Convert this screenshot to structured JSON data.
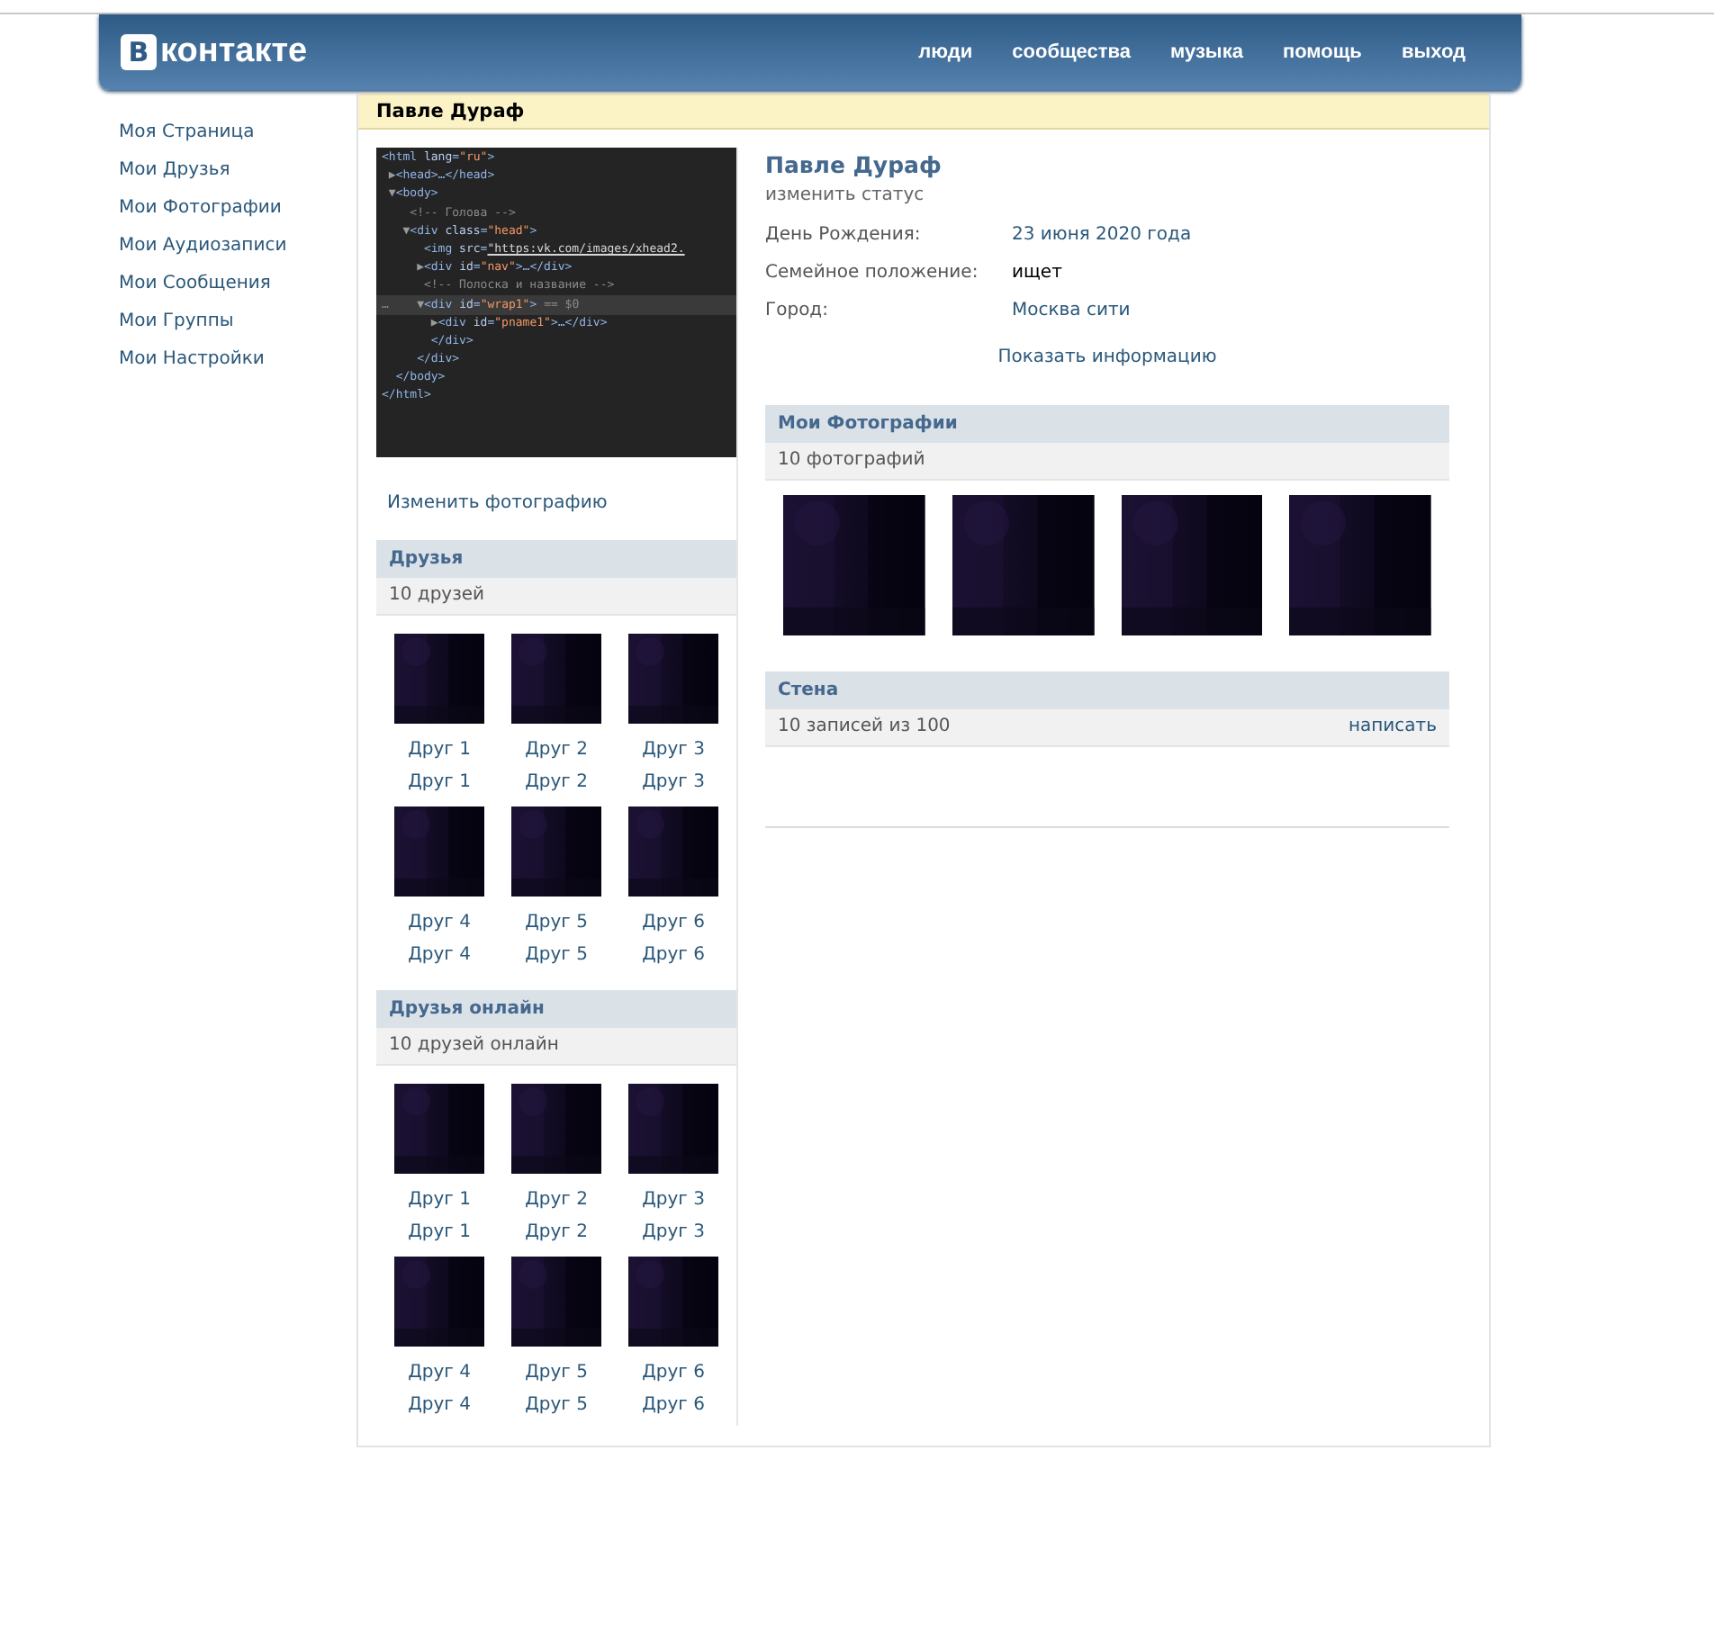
{
  "header": {
    "logo_mark": "В",
    "logo_text": "контакте",
    "nav": [
      "люди",
      "сообщества",
      "музыка",
      "помощь",
      "выход"
    ]
  },
  "sidebar": {
    "items": [
      "Моя Страница",
      "Мои Друзья",
      "Мои Фотографии",
      "Мои Аудиозаписи",
      "Мои Сообщения",
      "Мои Группы",
      "Мои Настройки"
    ]
  },
  "page_title": "Павле Дураф",
  "avatar_code": [
    {
      "highlighted": false,
      "segments": [
        {
          "kind": "tag",
          "text": "<html "
        },
        {
          "kind": "attr",
          "text": "lang"
        },
        {
          "kind": "tag",
          "text": "="
        },
        {
          "kind": "value",
          "text": "\"ru\""
        },
        {
          "kind": "tag",
          "text": ">"
        }
      ]
    },
    {
      "highlighted": false,
      "segments": [
        {
          "kind": "arrow",
          "text": " ▶"
        },
        {
          "kind": "tag",
          "text": "<head>…</head>"
        }
      ]
    },
    {
      "highlighted": false,
      "segments": [
        {
          "kind": "arrow",
          "text": " ▼"
        },
        {
          "kind": "tag",
          "text": "<body>"
        }
      ]
    },
    {
      "highlighted": false,
      "segments": [
        {
          "kind": "comment",
          "text": "    <!-- Голова -->"
        }
      ]
    },
    {
      "highlighted": false,
      "segments": [
        {
          "kind": "arrow",
          "text": "   ▼"
        },
        {
          "kind": "tag",
          "text": "<div "
        },
        {
          "kind": "attr",
          "text": "class"
        },
        {
          "kind": "tag",
          "text": "="
        },
        {
          "kind": "value",
          "text": "\"head\""
        },
        {
          "kind": "tag",
          "text": ">"
        }
      ]
    },
    {
      "highlighted": false,
      "segments": [
        {
          "kind": "tag",
          "text": "      <img "
        },
        {
          "kind": "attr",
          "text": "src"
        },
        {
          "kind": "tag",
          "text": "="
        },
        {
          "kind": "link",
          "text": "\"https:vk.com/images/xhead2."
        }
      ]
    },
    {
      "highlighted": false,
      "segments": [
        {
          "kind": "arrow",
          "text": "     ▶"
        },
        {
          "kind": "tag",
          "text": "<div "
        },
        {
          "kind": "attr",
          "text": "id"
        },
        {
          "kind": "tag",
          "text": "="
        },
        {
          "kind": "value",
          "text": "\"nav\""
        },
        {
          "kind": "tag",
          "text": ">…</div>"
        }
      ]
    },
    {
      "highlighted": false,
      "segments": [
        {
          "kind": "comment",
          "text": "      <!-- Полоска и название -->"
        }
      ]
    },
    {
      "highlighted": true,
      "segments": [
        {
          "kind": "comment",
          "text": "…"
        },
        {
          "kind": "arrow",
          "text": "    ▼"
        },
        {
          "kind": "tag",
          "text": "<div "
        },
        {
          "kind": "attr",
          "text": "id"
        },
        {
          "kind": "tag",
          "text": "="
        },
        {
          "kind": "value",
          "text": "\"wrap1\""
        },
        {
          "kind": "tag",
          "text": ">"
        },
        {
          "kind": "comment",
          "text": " == $0"
        }
      ]
    },
    {
      "highlighted": false,
      "segments": [
        {
          "kind": "arrow",
          "text": "       ▶"
        },
        {
          "kind": "tag",
          "text": "<div "
        },
        {
          "kind": "attr",
          "text": "id"
        },
        {
          "kind": "tag",
          "text": "="
        },
        {
          "kind": "value",
          "text": "\"pname1\""
        },
        {
          "kind": "tag",
          "text": ">…</div>"
        }
      ]
    },
    {
      "highlighted": false,
      "segments": [
        {
          "kind": "tag",
          "text": "       </div>"
        }
      ]
    },
    {
      "highlighted": false,
      "segments": [
        {
          "kind": "tag",
          "text": "     </div>"
        }
      ]
    },
    {
      "highlighted": false,
      "segments": [
        {
          "kind": "tag",
          "text": "  </body>"
        }
      ]
    },
    {
      "highlighted": false,
      "segments": [
        {
          "kind": "tag",
          "text": "</html>"
        }
      ]
    }
  ],
  "change_photo": "Изменить фотографию",
  "friends": {
    "title": "Друзья",
    "count": "10 друзей",
    "items": [
      {
        "kind": "picture",
        "line_1": "Друг 1",
        "line_2": "Друг 1"
      },
      {
        "kind": "picture",
        "line_1": "Друг 2",
        "line_2": "Друг 2"
      },
      {
        "kind": "picture",
        "line_1": "Друг 3",
        "line_2": "Друг 3"
      },
      {
        "kind": "picture",
        "line_1": "Друг 4",
        "line_2": "Друг 4"
      },
      {
        "kind": "picture",
        "line_1": "Друг 5",
        "line_2": "Друг 5"
      },
      {
        "kind": "picture",
        "line_1": "Друг 6",
        "line_2": "Друг 6"
      }
    ]
  },
  "friends_online": {
    "title": "Друзья онлайн",
    "count": "10 друзей онлайн",
    "items": [
      {
        "kind": "picture",
        "line_1": "Друг 1",
        "line_2": "Друг 1"
      },
      {
        "kind": "picture",
        "line_1": "Друг 2",
        "line_2": "Друг 2"
      },
      {
        "kind": "picture",
        "line_1": "Друг 3",
        "line_2": "Друг 3"
      },
      {
        "kind": "picture",
        "line_1": "Друг 4",
        "line_2": "Друг 4"
      },
      {
        "kind": "picture",
        "line_1": "Друг 5",
        "line_2": "Друг 5"
      },
      {
        "kind": "picture",
        "line_1": "Друг 6",
        "line_2": "Друг 6"
      }
    ]
  },
  "profile": {
    "name": "Павле Дураф",
    "status": "изменить статус",
    "fields": [
      {
        "label": "День Рождения:",
        "value": "23 июня 2020 года",
        "kind": "link"
      },
      {
        "label": "Семейное положение:",
        "value": "ищет",
        "kind": "plain"
      },
      {
        "label": "Город:",
        "value": "Москва сити",
        "kind": "link"
      }
    ],
    "show_info": "Показать информацию"
  },
  "photos": {
    "title": "Мои Фотографии",
    "count": "10 фотографий"
  },
  "wall": {
    "title": "Стена",
    "count": "10 записей из 100",
    "write": "написать"
  }
}
